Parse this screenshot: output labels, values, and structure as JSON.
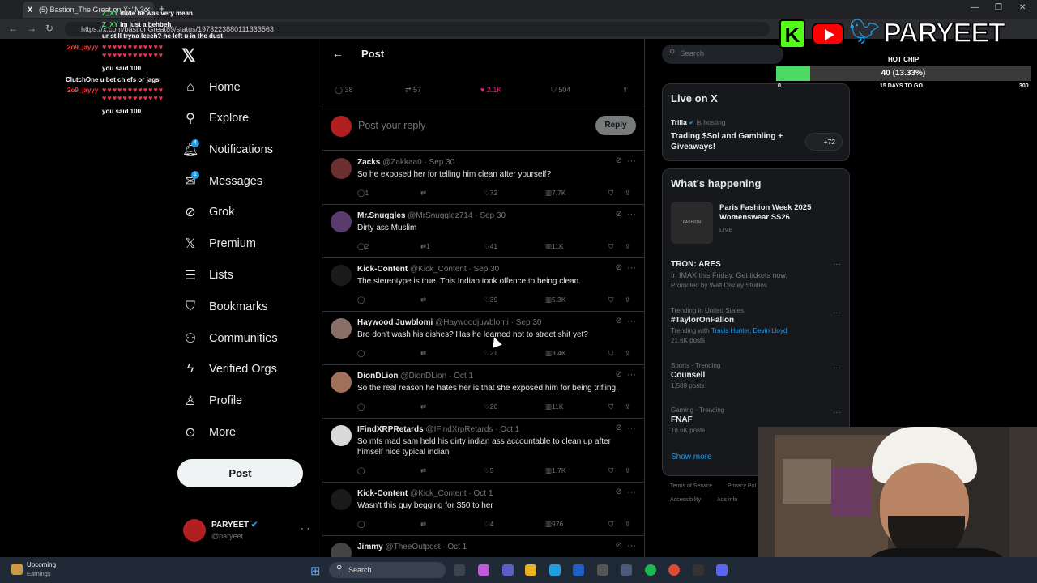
{
  "browser": {
    "tab_title": "(5) Bastion_The Great on X: \"N3c",
    "url": "https://x.com/bastionGreat89/status/1973223880111333563"
  },
  "chat": [
    {
      "user": "Z_XY",
      "text": "dude he was very mean"
    },
    {
      "user": "Z_XY",
      "text": "Im just a behbeh"
    },
    {
      "user": "",
      "text": "ur still tryna leech? he left u in the dust"
    },
    {
      "user": "2o9_jayyy",
      "text": ""
    },
    {
      "user": "",
      "text": "you said 100"
    },
    {
      "user": "ClutchOne",
      "text": "u bet chiefs or jags"
    },
    {
      "user": "2o9_jayyy",
      "text": ""
    },
    {
      "user": "",
      "text": "you said 100"
    }
  ],
  "sidebar": {
    "items": [
      {
        "label": "Home",
        "icon": "home-icon"
      },
      {
        "label": "Explore",
        "icon": "search-icon"
      },
      {
        "label": "Notifications",
        "icon": "bell-icon",
        "badge": "4"
      },
      {
        "label": "Messages",
        "icon": "mail-icon",
        "badge": "1"
      },
      {
        "label": "Grok",
        "icon": "grok-icon"
      },
      {
        "label": "Premium",
        "icon": "x-logo-icon"
      },
      {
        "label": "Lists",
        "icon": "list-icon"
      },
      {
        "label": "Bookmarks",
        "icon": "bookmark-icon"
      },
      {
        "label": "Communities",
        "icon": "people-icon"
      },
      {
        "label": "Verified Orgs",
        "icon": "bolt-icon"
      },
      {
        "label": "Profile",
        "icon": "person-icon"
      },
      {
        "label": "More",
        "icon": "more-circle-icon"
      }
    ],
    "post_label": "Post",
    "account": {
      "name": "PARYEET",
      "handle": "@paryeet"
    }
  },
  "post": {
    "header_title": "Post",
    "stats": {
      "replies": "38",
      "reposts": "57",
      "likes": "2.1K",
      "bookmarks": "504"
    },
    "reply_placeholder": "Post your reply",
    "reply_button": "Reply"
  },
  "replies": [
    {
      "name": "Zacks",
      "handle": "@Zakkaa0",
      "date": "Sep 30",
      "text": "So he exposed her for telling him clean after yourself?",
      "replies": "1",
      "reposts": "",
      "likes": "72",
      "views": "7.7K",
      "avatar": "#6b2f2f"
    },
    {
      "name": "Mr.Snuggles",
      "handle": "@MrSnugglez714",
      "date": "Sep 30",
      "text": "Dirty ass Muslim",
      "replies": "2",
      "reposts": "1",
      "likes": "41",
      "views": "11K",
      "avatar": "#5b3a6e"
    },
    {
      "name": "Kick-Content",
      "handle": "@Kick_Content",
      "date": "Sep 30",
      "text": "The stereotype is true. This Indian took offence to being clean.",
      "replies": "",
      "reposts": "",
      "likes": "39",
      "views": "5.3K",
      "avatar": "#1a1a1a"
    },
    {
      "name": "Haywood Juwblomi",
      "handle": "@Haywoodjuwblomi",
      "date": "Sep 30",
      "text": "Bro don't wash his dishes? Has he learned not to street shit yet?",
      "replies": "",
      "reposts": "",
      "likes": "21",
      "views": "3.4K",
      "avatar": "#8a6f68"
    },
    {
      "name": "DionDLion",
      "handle": "@DionDLion",
      "date": "Oct 1",
      "text": "So the real reason he hates her is that she exposed him for being trifling.",
      "replies": "",
      "reposts": "",
      "likes": "20",
      "views": "11K",
      "avatar": "#a0705a"
    },
    {
      "name": "IFindXRPRetards",
      "handle": "@IFindXrpRetards",
      "date": "Oct 1",
      "text": "So mfs mad sam held his dirty indian ass accountable to clean up after himself nice typical indian",
      "replies": "",
      "reposts": "",
      "likes": "5",
      "views": "1.7K",
      "avatar": "#d9d9d9"
    },
    {
      "name": "Kick-Content",
      "handle": "@Kick_Content",
      "date": "Oct 1",
      "text": "Wasn't this guy begging for $50 to her",
      "replies": "",
      "reposts": "",
      "likes": "4",
      "views": "976",
      "avatar": "#1a1a1a"
    },
    {
      "name": "Jimmy",
      "handle": "@TheeOutpost",
      "date": "Oct 1",
      "text": "",
      "replies": "",
      "reposts": "",
      "likes": "",
      "views": "",
      "avatar": "#444"
    }
  ],
  "right": {
    "search_placeholder": "Search",
    "live": {
      "title": "Live on X",
      "host": "Trilla",
      "hosting": "is hosting",
      "space_title": "Trading $Sol and Gambling + Giveaways!",
      "listeners": "+72"
    },
    "happening": {
      "title": "What's happening",
      "featured": {
        "title": "Paris Fashion Week 2025 Womenswear SS26",
        "status": "LIVE",
        "thumb": "FASHION"
      },
      "promo": {
        "title": "TRON: ARES",
        "desc": "In IMAX this Friday. Get tickets now.",
        "by": "Promoted by Walt Disney Studios"
      },
      "trends": [
        {
          "meta": "Trending in United States",
          "title": "#TaylorOnFallon",
          "with_label": "Trending with",
          "with": "Travis Hunter, Devin Lloyd",
          "posts": "21.6K posts"
        },
        {
          "meta": "Sports · Trending",
          "title": "Counsell",
          "posts": "1,589 posts"
        },
        {
          "meta": "Gaming · Trending",
          "title": "FNAF",
          "posts": "18.6K posts"
        }
      ],
      "show_more": "Show more"
    },
    "footer": [
      "Terms of Service",
      "Privacy Pol",
      "Accessibility",
      "Ads info"
    ]
  },
  "overlay": {
    "brand": "PARYEET",
    "goal_label": "HOT CHIP",
    "goal_text": "40 (13.33%)",
    "goal_fraction": 0.1333,
    "goal_min": "0",
    "goal_max": "300",
    "goal_sub": "15 DAYS TO GO"
  },
  "taskbar": {
    "weather_title": "Upcoming",
    "weather_sub": "Earnings",
    "search": "Search"
  }
}
